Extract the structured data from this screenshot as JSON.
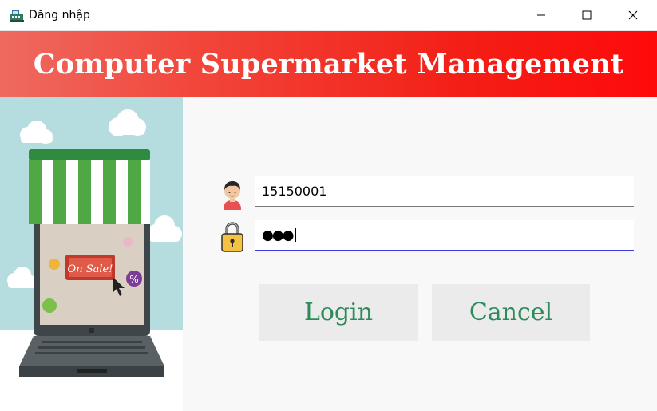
{
  "window": {
    "title": "Đăng nhập",
    "icon": "cash-register-icon",
    "controls": [
      "minimize-icon",
      "maximize-icon",
      "close-icon"
    ]
  },
  "header": {
    "title": "Computer Supermarket Management",
    "gradient_colors": [
      "#ee6a60",
      "#ff0a0a"
    ],
    "text_color": "#ffffff"
  },
  "illustration": {
    "icon": "online-shop-laptop-illustration",
    "sign_text": "On Sale!",
    "badge_text": "%"
  },
  "form": {
    "username": {
      "icon": "user-icon",
      "value": "15150001"
    },
    "password": {
      "icon": "lock-icon",
      "masked_value": "●●●"
    }
  },
  "buttons": {
    "login_label": "Login",
    "cancel_label": "Cancel",
    "text_color": "#2d8a5a",
    "bg_color": "#ebebeb"
  }
}
